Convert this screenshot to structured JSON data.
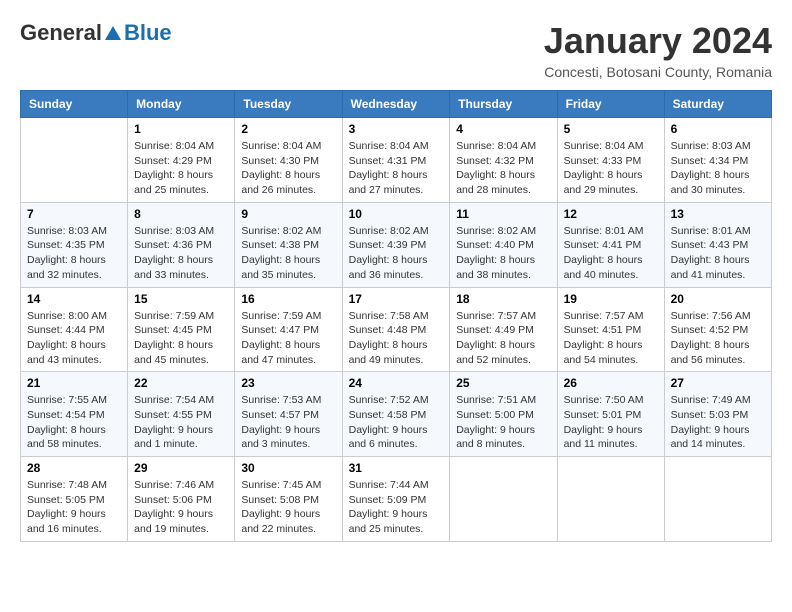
{
  "header": {
    "logo_general": "General",
    "logo_blue": "Blue",
    "month_title": "January 2024",
    "location": "Concesti, Botosani County, Romania"
  },
  "days_of_week": [
    "Sunday",
    "Monday",
    "Tuesday",
    "Wednesday",
    "Thursday",
    "Friday",
    "Saturday"
  ],
  "weeks": [
    [
      {
        "day": "",
        "info": ""
      },
      {
        "day": "1",
        "info": "Sunrise: 8:04 AM\nSunset: 4:29 PM\nDaylight: 8 hours\nand 25 minutes."
      },
      {
        "day": "2",
        "info": "Sunrise: 8:04 AM\nSunset: 4:30 PM\nDaylight: 8 hours\nand 26 minutes."
      },
      {
        "day": "3",
        "info": "Sunrise: 8:04 AM\nSunset: 4:31 PM\nDaylight: 8 hours\nand 27 minutes."
      },
      {
        "day": "4",
        "info": "Sunrise: 8:04 AM\nSunset: 4:32 PM\nDaylight: 8 hours\nand 28 minutes."
      },
      {
        "day": "5",
        "info": "Sunrise: 8:04 AM\nSunset: 4:33 PM\nDaylight: 8 hours\nand 29 minutes."
      },
      {
        "day": "6",
        "info": "Sunrise: 8:03 AM\nSunset: 4:34 PM\nDaylight: 8 hours\nand 30 minutes."
      }
    ],
    [
      {
        "day": "7",
        "info": "Sunrise: 8:03 AM\nSunset: 4:35 PM\nDaylight: 8 hours\nand 32 minutes."
      },
      {
        "day": "8",
        "info": "Sunrise: 8:03 AM\nSunset: 4:36 PM\nDaylight: 8 hours\nand 33 minutes."
      },
      {
        "day": "9",
        "info": "Sunrise: 8:02 AM\nSunset: 4:38 PM\nDaylight: 8 hours\nand 35 minutes."
      },
      {
        "day": "10",
        "info": "Sunrise: 8:02 AM\nSunset: 4:39 PM\nDaylight: 8 hours\nand 36 minutes."
      },
      {
        "day": "11",
        "info": "Sunrise: 8:02 AM\nSunset: 4:40 PM\nDaylight: 8 hours\nand 38 minutes."
      },
      {
        "day": "12",
        "info": "Sunrise: 8:01 AM\nSunset: 4:41 PM\nDaylight: 8 hours\nand 40 minutes."
      },
      {
        "day": "13",
        "info": "Sunrise: 8:01 AM\nSunset: 4:43 PM\nDaylight: 8 hours\nand 41 minutes."
      }
    ],
    [
      {
        "day": "14",
        "info": "Sunrise: 8:00 AM\nSunset: 4:44 PM\nDaylight: 8 hours\nand 43 minutes."
      },
      {
        "day": "15",
        "info": "Sunrise: 7:59 AM\nSunset: 4:45 PM\nDaylight: 8 hours\nand 45 minutes."
      },
      {
        "day": "16",
        "info": "Sunrise: 7:59 AM\nSunset: 4:47 PM\nDaylight: 8 hours\nand 47 minutes."
      },
      {
        "day": "17",
        "info": "Sunrise: 7:58 AM\nSunset: 4:48 PM\nDaylight: 8 hours\nand 49 minutes."
      },
      {
        "day": "18",
        "info": "Sunrise: 7:57 AM\nSunset: 4:49 PM\nDaylight: 8 hours\nand 52 minutes."
      },
      {
        "day": "19",
        "info": "Sunrise: 7:57 AM\nSunset: 4:51 PM\nDaylight: 8 hours\nand 54 minutes."
      },
      {
        "day": "20",
        "info": "Sunrise: 7:56 AM\nSunset: 4:52 PM\nDaylight: 8 hours\nand 56 minutes."
      }
    ],
    [
      {
        "day": "21",
        "info": "Sunrise: 7:55 AM\nSunset: 4:54 PM\nDaylight: 8 hours\nand 58 minutes."
      },
      {
        "day": "22",
        "info": "Sunrise: 7:54 AM\nSunset: 4:55 PM\nDaylight: 9 hours\nand 1 minute."
      },
      {
        "day": "23",
        "info": "Sunrise: 7:53 AM\nSunset: 4:57 PM\nDaylight: 9 hours\nand 3 minutes."
      },
      {
        "day": "24",
        "info": "Sunrise: 7:52 AM\nSunset: 4:58 PM\nDaylight: 9 hours\nand 6 minutes."
      },
      {
        "day": "25",
        "info": "Sunrise: 7:51 AM\nSunset: 5:00 PM\nDaylight: 9 hours\nand 8 minutes."
      },
      {
        "day": "26",
        "info": "Sunrise: 7:50 AM\nSunset: 5:01 PM\nDaylight: 9 hours\nand 11 minutes."
      },
      {
        "day": "27",
        "info": "Sunrise: 7:49 AM\nSunset: 5:03 PM\nDaylight: 9 hours\nand 14 minutes."
      }
    ],
    [
      {
        "day": "28",
        "info": "Sunrise: 7:48 AM\nSunset: 5:05 PM\nDaylight: 9 hours\nand 16 minutes."
      },
      {
        "day": "29",
        "info": "Sunrise: 7:46 AM\nSunset: 5:06 PM\nDaylight: 9 hours\nand 19 minutes."
      },
      {
        "day": "30",
        "info": "Sunrise: 7:45 AM\nSunset: 5:08 PM\nDaylight: 9 hours\nand 22 minutes."
      },
      {
        "day": "31",
        "info": "Sunrise: 7:44 AM\nSunset: 5:09 PM\nDaylight: 9 hours\nand 25 minutes."
      },
      {
        "day": "",
        "info": ""
      },
      {
        "day": "",
        "info": ""
      },
      {
        "day": "",
        "info": ""
      }
    ]
  ]
}
